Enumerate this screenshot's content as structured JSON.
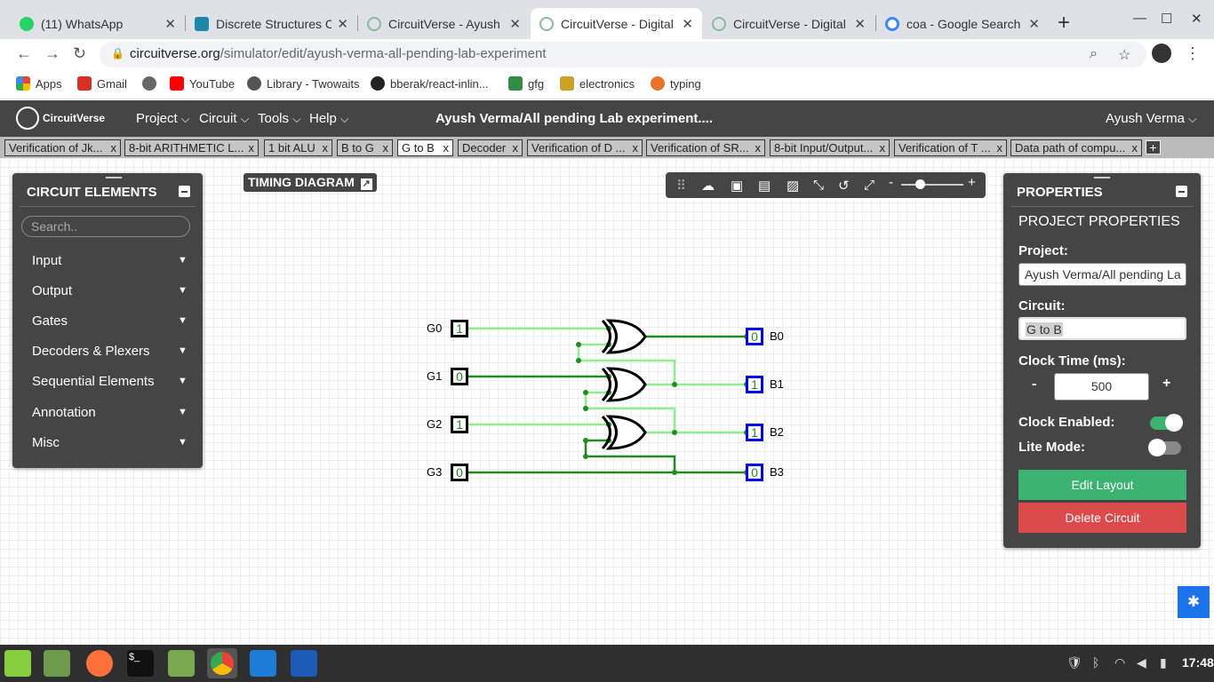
{
  "browser": {
    "tabs": [
      {
        "title": "(11) WhatsApp",
        "color": "#25d366"
      },
      {
        "title": "Discrete Structures Cla",
        "color": "#1e88a8"
      },
      {
        "title": "CircuitVerse - Ayush Ve",
        "color": "#8bb8a0"
      },
      {
        "title": "CircuitVerse - Digital Ci",
        "color": "#8bb8a0"
      },
      {
        "title": "CircuitVerse - Digital Ci",
        "color": "#8bb8a0"
      },
      {
        "title": "coa - Google Search",
        "color": "#4285f4"
      }
    ],
    "active_tab": 3,
    "url_domain": "circuitverse.org",
    "url_path": "/simulator/edit/ayush-verma-all-pending-lab-experiment",
    "bookmarks": [
      {
        "label": "Apps",
        "color": "#ea4335"
      },
      {
        "label": "Gmail",
        "color": "#d93025"
      },
      {
        "label": "",
        "color": "#666666"
      },
      {
        "label": "YouTube",
        "color": "#ff0000"
      },
      {
        "label": "Library - Twowaits",
        "color": "#555555"
      },
      {
        "label": "bberak/react-inlin...",
        "color": "#222222"
      },
      {
        "label": "gfg",
        "color": "#2f8d46"
      },
      {
        "label": "electronics",
        "color": "#c9a227"
      },
      {
        "label": "typing",
        "color": "#e8742a"
      }
    ]
  },
  "cv": {
    "logo": "CircuitVerse",
    "menus": [
      "Project",
      "Circuit",
      "Tools",
      "Help"
    ],
    "project_title": "Ayush Verma/All pending Lab experiment....",
    "user": "Ayush Verma",
    "circuit_tabs": [
      "Verification of Jk...",
      "8-bit ARITHMETIC L...",
      "1 bit ALU",
      "B to G",
      "G to B",
      "Decoder",
      "Verification of D ...",
      "Verification of SR...",
      "8-bit Input/Output...",
      "Verification of T ...",
      "Data path of compu..."
    ],
    "tab_close": "x",
    "tab_add": "+",
    "timing_diagram": "TIMING DIAGRAM",
    "circuit_elements": {
      "title": "CIRCUIT ELEMENTS",
      "search_placeholder": "Search..",
      "categories": [
        "Input",
        "Output",
        "Gates",
        "Decoders & Plexers",
        "Sequential Elements",
        "Annotation",
        "Misc"
      ]
    },
    "properties": {
      "title": "PROPERTIES",
      "subtitle": "PROJECT PROPERTIES",
      "project_label": "Project:",
      "project_value": "Ayush Verma/All pending La",
      "circuit_label": "Circuit:",
      "circuit_value": "G to B",
      "clock_label": "Clock Time (ms):",
      "clock_value": "500",
      "minus": "-",
      "plus": "+",
      "clock_enabled_label": "Clock Enabled:",
      "clock_enabled": true,
      "lite_mode_label": "Lite Mode:",
      "lite_mode": false,
      "edit_layout": "Edit Layout",
      "delete_circuit": "Delete Circuit",
      "edit_color": "#3cb371",
      "delete_color": "#dc4b4b"
    },
    "circuit": {
      "inputs": [
        {
          "label": "G0",
          "value": "1"
        },
        {
          "label": "G1",
          "value": "0"
        },
        {
          "label": "G2",
          "value": "1"
        },
        {
          "label": "G3",
          "value": "0"
        }
      ],
      "outputs": [
        {
          "label": "B0",
          "value": "0"
        },
        {
          "label": "B1",
          "value": "1"
        },
        {
          "label": "B2",
          "value": "1"
        },
        {
          "label": "B3",
          "value": "0"
        }
      ]
    },
    "zoom_minus": "-",
    "zoom_plus": "+",
    "zoom_level": 0.3
  },
  "taskbar": {
    "time": "17:48"
  }
}
